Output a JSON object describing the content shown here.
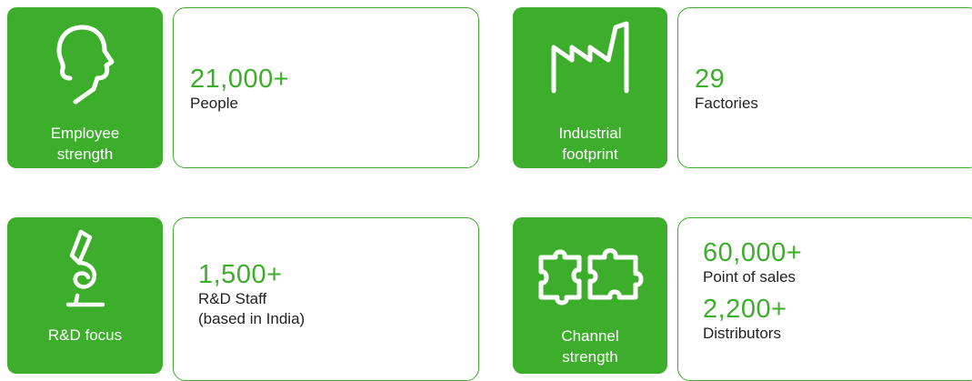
{
  "colors": {
    "accent": "#3dae2b",
    "text": "#222222",
    "background": "#ffffff"
  },
  "stats": {
    "employee": {
      "icon": "head-profile-icon",
      "label_line1": "Employee",
      "label_line2": "strength",
      "value": "21,000+",
      "desc": "People"
    },
    "industrial": {
      "icon": "factory-icon",
      "label_line1": "Industrial",
      "label_line2": "footprint",
      "value": "29",
      "desc": "Factories"
    },
    "rnd": {
      "icon": "microscope-icon",
      "label_line1": "R&D focus",
      "value": "1,500+",
      "desc_line1": "R&D Staff",
      "desc_line2": "(based in India)"
    },
    "channel": {
      "icon": "puzzle-icon",
      "label_line1": "Channel",
      "label_line2": "strength",
      "value1": "60,000+",
      "desc1": "Point of sales",
      "value2": "2,200+",
      "desc2": "Distributors"
    }
  }
}
